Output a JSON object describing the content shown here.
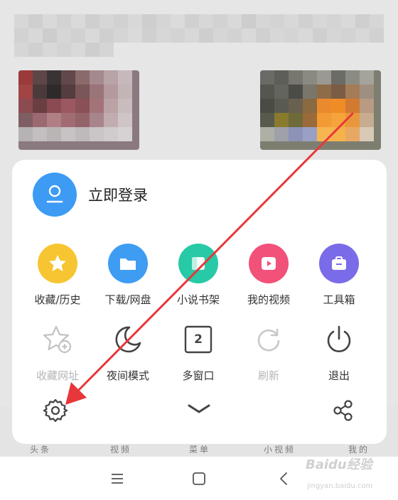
{
  "background": {
    "tabs": [
      "头条",
      "视频",
      "菜单",
      "小视频",
      "我的"
    ]
  },
  "menu": {
    "login_label": "立即登录",
    "row1": [
      {
        "label": "收藏/历史",
        "icon": "star-icon",
        "color": "#f7c531"
      },
      {
        "label": "下载/网盘",
        "icon": "folder-icon",
        "color": "#3f9cf3"
      },
      {
        "label": "小说书架",
        "icon": "book-icon",
        "color": "#27c9a6"
      },
      {
        "label": "我的视频",
        "icon": "play-icon",
        "color": "#f2517a"
      },
      {
        "label": "工具箱",
        "icon": "toolbox-icon",
        "color": "#7a6be8"
      }
    ],
    "row2": [
      {
        "label": "收藏网址",
        "icon": "star-add-icon",
        "disabled": true
      },
      {
        "label": "夜间模式",
        "icon": "moon-icon",
        "disabled": false
      },
      {
        "label": "多窗口",
        "icon": "window-count-icon",
        "disabled": false,
        "count": "2"
      },
      {
        "label": "刷新",
        "icon": "refresh-icon",
        "disabled": true
      },
      {
        "label": "退出",
        "icon": "power-icon",
        "disabled": false
      }
    ],
    "bottom": {
      "settings_icon": "gear-icon",
      "collapse_icon": "chevron-down-icon",
      "share_icon": "share-icon"
    }
  },
  "watermark": {
    "brand": "Baidu经验",
    "url": "jingyan.baidu.com"
  },
  "colors": {
    "accent": "#3d9bf4",
    "annotation": "#e8373a"
  }
}
